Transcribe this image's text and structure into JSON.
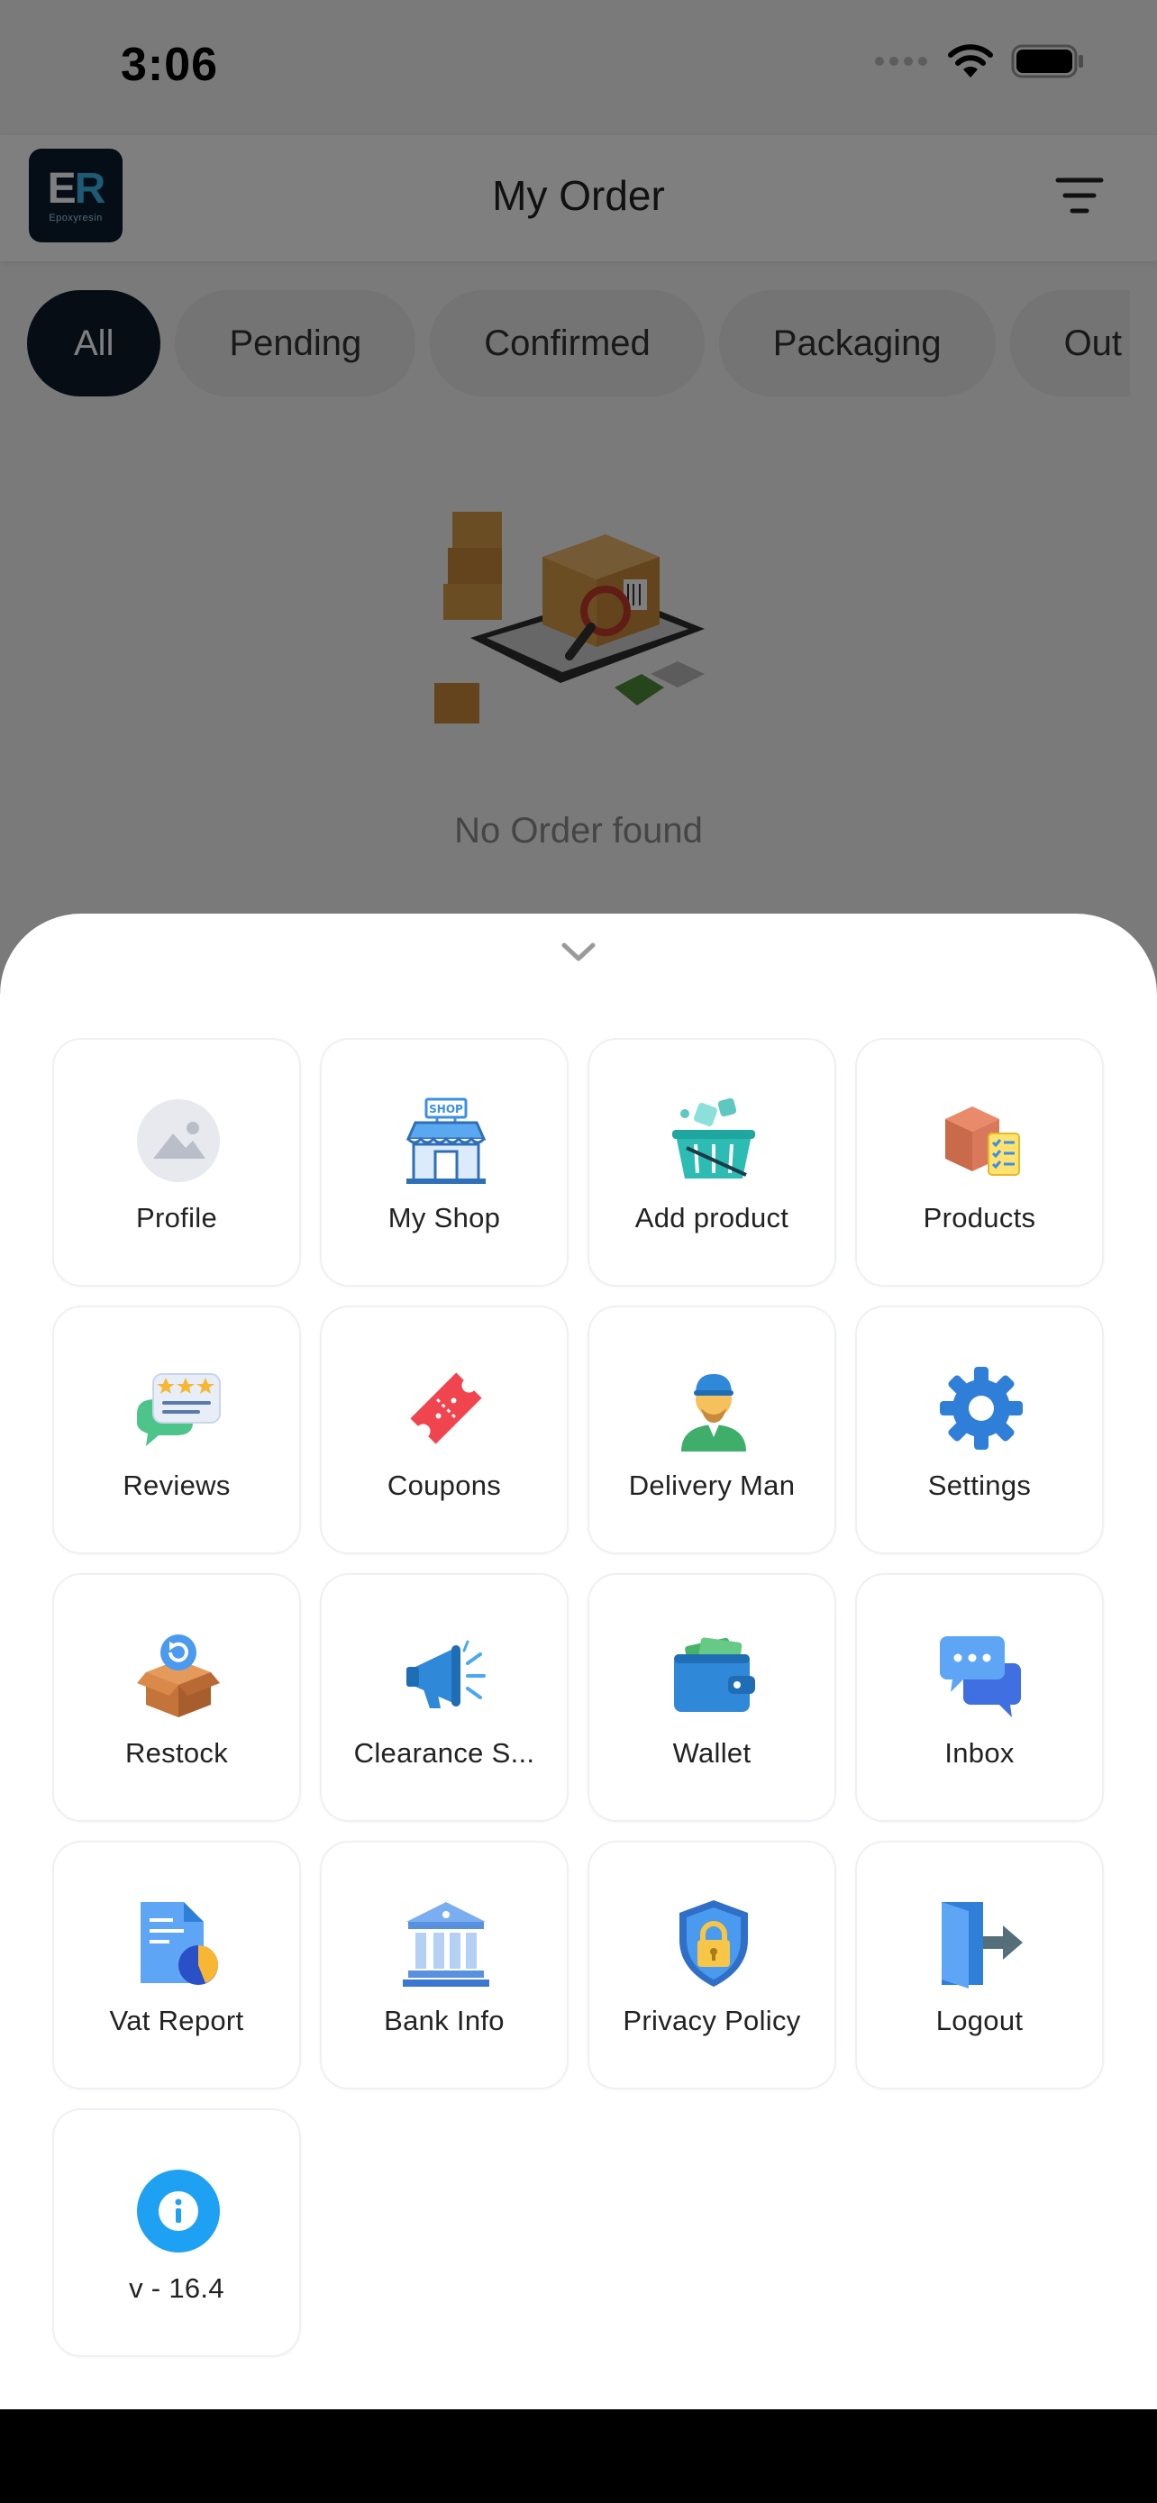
{
  "status_bar": {
    "time": "3:06"
  },
  "header": {
    "logo": {
      "mark_left": "E",
      "mark_right": "R",
      "sub": "Epoxyresin"
    },
    "title": "My Order"
  },
  "tabs": [
    {
      "label": "All"
    },
    {
      "label": "Pending"
    },
    {
      "label": "Confirmed"
    },
    {
      "label": "Packaging"
    },
    {
      "label": "Out for delivery"
    }
  ],
  "empty_state": {
    "text": "No Order found"
  },
  "menu": [
    {
      "label": "Profile",
      "icon": "image-placeholder-icon"
    },
    {
      "label": "My Shop",
      "icon": "shop-icon"
    },
    {
      "label": "Add product",
      "icon": "basket-icon"
    },
    {
      "label": "Products",
      "icon": "package-list-icon"
    },
    {
      "label": "Reviews",
      "icon": "reviews-icon"
    },
    {
      "label": "Coupons",
      "icon": "coupon-icon"
    },
    {
      "label": "Delivery Man",
      "icon": "delivery-man-icon"
    },
    {
      "label": "Settings",
      "icon": "gear-icon"
    },
    {
      "label": "Restock",
      "icon": "restock-icon"
    },
    {
      "label": "Clearance S...",
      "icon": "megaphone-icon"
    },
    {
      "label": "Wallet",
      "icon": "wallet-icon"
    },
    {
      "label": "Inbox",
      "icon": "chat-icon"
    },
    {
      "label": "Vat Report",
      "icon": "report-icon"
    },
    {
      "label": "Bank Info",
      "icon": "bank-icon"
    },
    {
      "label": "Privacy Policy",
      "icon": "shield-lock-icon"
    },
    {
      "label": "Logout",
      "icon": "logout-icon"
    },
    {
      "label": "v - 16.4",
      "icon": "info-icon"
    }
  ],
  "colors": {
    "active_tab": "#0d1b2a",
    "scrim": "rgba(0,0,0,0.5)",
    "accent_blue": "#3b8fe6"
  }
}
